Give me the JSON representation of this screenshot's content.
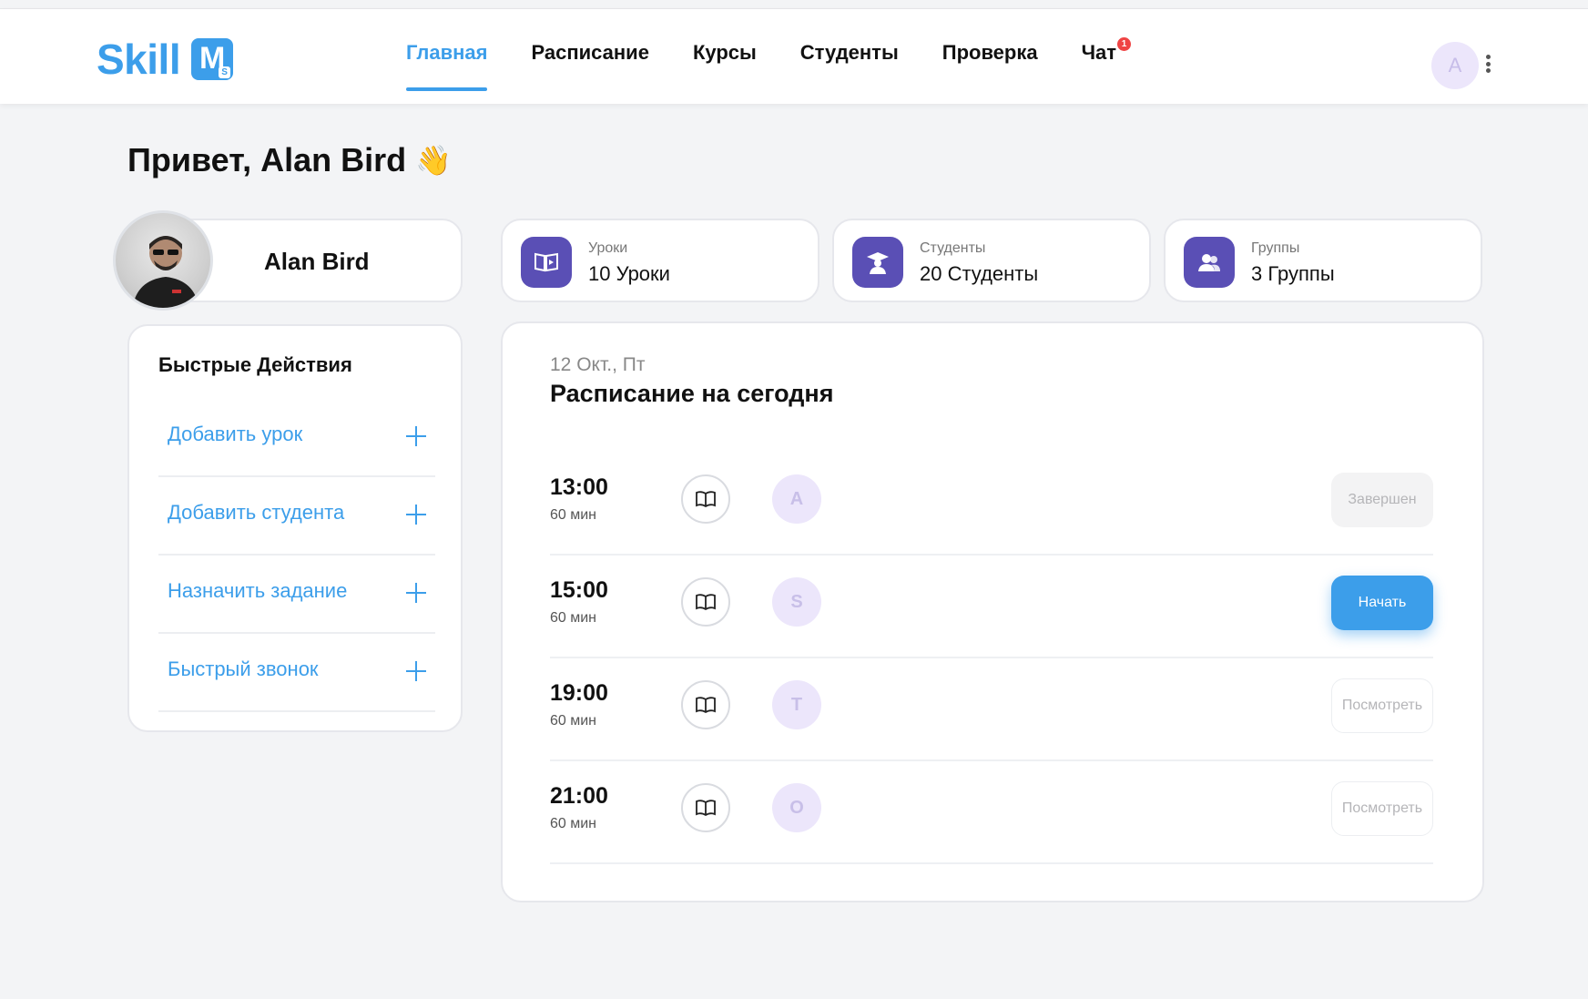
{
  "header": {
    "logo_text": "Skill",
    "logo_mark": "M",
    "logo_mark_sub": "S",
    "nav": [
      {
        "label": "Главная",
        "active": true
      },
      {
        "label": "Расписание"
      },
      {
        "label": "Курсы"
      },
      {
        "label": "Студенты"
      },
      {
        "label": "Проверка"
      },
      {
        "label": "Чат",
        "badge": "1"
      }
    ],
    "user_initial": "A"
  },
  "greeting": {
    "text": "Привет, Alan Bird",
    "emoji": "👋"
  },
  "profile": {
    "name": "Alan Bird"
  },
  "stats": [
    {
      "label": "Уроки",
      "value": "10 Уроки",
      "icon": "lessons-book-icon"
    },
    {
      "label": "Студенты",
      "value": "20 Студенты",
      "icon": "graduate-icon"
    },
    {
      "label": "Группы",
      "value": "3 Группы",
      "icon": "group-users-icon"
    }
  ],
  "quick_actions": {
    "title": "Быстрые Действия",
    "items": [
      {
        "label": "Добавить урок"
      },
      {
        "label": "Добавить студента"
      },
      {
        "label": "Назначить задание"
      },
      {
        "label": "Быстрый звонок"
      }
    ]
  },
  "schedule": {
    "date": "12 Окт., Пт",
    "title": "Расписание на сегодня",
    "rows": [
      {
        "time": "13:00",
        "duration": "60 мин",
        "student": "A",
        "action": "Завершен",
        "status": "done"
      },
      {
        "time": "15:00",
        "duration": "60 мин",
        "student": "S",
        "action": "Начать",
        "status": "start"
      },
      {
        "time": "19:00",
        "duration": "60 мин",
        "student": "T",
        "action": "Посмотреть",
        "status": "view"
      },
      {
        "time": "21:00",
        "duration": "60 мин",
        "student": "O",
        "action": "Посмотреть",
        "status": "view"
      }
    ]
  },
  "colors": {
    "accent": "#3c9eea",
    "icon_bg": "#5a4fb5",
    "avatar_bg": "#ece6fb",
    "badge": "#ef4444"
  }
}
